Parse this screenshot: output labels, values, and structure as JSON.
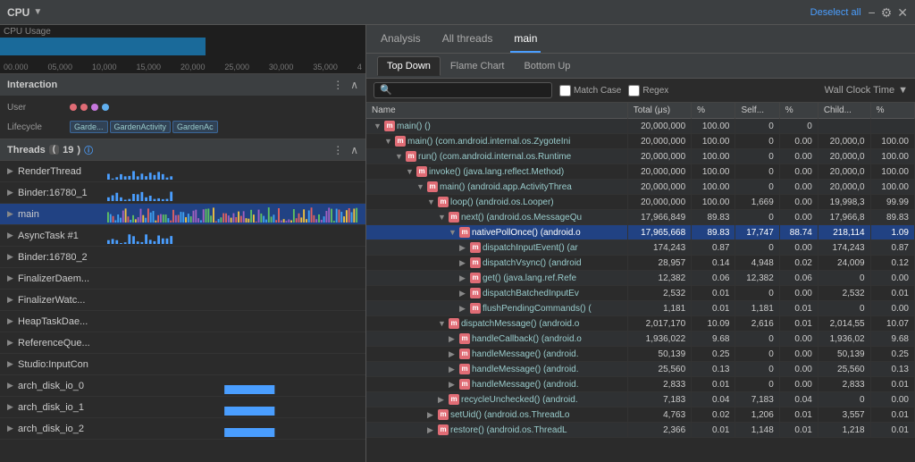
{
  "topbar": {
    "cpu_label": "CPU",
    "deselect_all": "Deselect all"
  },
  "tabs": {
    "items": [
      "Analysis",
      "All threads",
      "main"
    ],
    "active": "main"
  },
  "sub_tabs": {
    "items": [
      "Top Down",
      "Flame Chart",
      "Bottom Up"
    ],
    "active": "Top Down"
  },
  "search": {
    "placeholder": "🔍",
    "match_case": "Match Case",
    "regex": "Regex",
    "wall_clock": "Wall Clock Time"
  },
  "table": {
    "headers": [
      "Name",
      "Total (μs)",
      "%",
      "Self...",
      "%",
      "Child...",
      "%"
    ],
    "rows": [
      {
        "indent": 0,
        "expand": "▼",
        "icon": "m",
        "name": "main() ()",
        "total": "20,000,000",
        "total_pct": "100.00",
        "self": "0",
        "self_pct": "0",
        "child": "",
        "child_pct": "",
        "selected": false
      },
      {
        "indent": 1,
        "expand": "▼",
        "icon": "m",
        "name": "main() (com.android.internal.os.ZygoteIni",
        "total": "20,000,000",
        "total_pct": "100.00",
        "self": "0",
        "self_pct": "0.00",
        "child": "20,000,0",
        "child_pct": "100.00",
        "selected": false
      },
      {
        "indent": 2,
        "expand": "▼",
        "icon": "m",
        "name": "run() (com.android.internal.os.Runtime",
        "total": "20,000,000",
        "total_pct": "100.00",
        "self": "0",
        "self_pct": "0.00",
        "child": "20,000,0",
        "child_pct": "100.00",
        "selected": false
      },
      {
        "indent": 3,
        "expand": "▼",
        "icon": "m",
        "name": "invoke() (java.lang.reflect.Method)",
        "total": "20,000,000",
        "total_pct": "100.00",
        "self": "0",
        "self_pct": "0.00",
        "child": "20,000,0",
        "child_pct": "100.00",
        "selected": false
      },
      {
        "indent": 4,
        "expand": "▼",
        "icon": "m",
        "name": "main() (android.app.ActivityThrea",
        "total": "20,000,000",
        "total_pct": "100.00",
        "self": "0",
        "self_pct": "0.00",
        "child": "20,000,0",
        "child_pct": "100.00",
        "selected": false
      },
      {
        "indent": 5,
        "expand": "▼",
        "icon": "m",
        "name": "loop() (android.os.Looper)",
        "total": "20,000,000",
        "total_pct": "100.00",
        "self": "1,669",
        "self_pct": "0.00",
        "child": "19,998,3",
        "child_pct": "99.99",
        "selected": false
      },
      {
        "indent": 6,
        "expand": "▼",
        "icon": "m",
        "name": "next() (android.os.MessageQu",
        "total": "17,966,849",
        "total_pct": "89.83",
        "self": "0",
        "self_pct": "0.00",
        "child": "17,966,8",
        "child_pct": "89.83",
        "selected": false
      },
      {
        "indent": 7,
        "expand": "▼",
        "icon": "m",
        "name": "nativePollOnce() (android.o",
        "total": "17,965,668",
        "total_pct": "89.83",
        "self": "17,747",
        "self_pct": "88.74",
        "child": "218,114",
        "child_pct": "1.09",
        "selected": true
      },
      {
        "indent": 8,
        "expand": "▶",
        "icon": "m",
        "name": "dispatchInputEvent() (ar",
        "total": "174,243",
        "total_pct": "0.87",
        "self": "0",
        "self_pct": "0.00",
        "child": "174,243",
        "child_pct": "0.87",
        "selected": false
      },
      {
        "indent": 8,
        "expand": "▶",
        "icon": "m",
        "name": "dispatchVsync() (android",
        "total": "28,957",
        "total_pct": "0.14",
        "self": "4,948",
        "self_pct": "0.02",
        "child": "24,009",
        "child_pct": "0.12",
        "selected": false
      },
      {
        "indent": 8,
        "expand": "▶",
        "icon": "m",
        "name": "get() (java.lang.ref.Refe",
        "total": "12,382",
        "total_pct": "0.06",
        "self": "12,382",
        "self_pct": "0.06",
        "child": "0",
        "child_pct": "0.00",
        "selected": false
      },
      {
        "indent": 8,
        "expand": "▶",
        "icon": "m",
        "name": "dispatchBatchedInputEv",
        "total": "2,532",
        "total_pct": "0.01",
        "self": "0",
        "self_pct": "0.00",
        "child": "2,532",
        "child_pct": "0.01",
        "selected": false
      },
      {
        "indent": 8,
        "expand": "▶",
        "icon": "m",
        "name": "flushPendingCommands() (",
        "total": "1,181",
        "total_pct": "0.01",
        "self": "1,181",
        "self_pct": "0.01",
        "child": "0",
        "child_pct": "0.00",
        "selected": false
      },
      {
        "indent": 6,
        "expand": "▼",
        "icon": "m",
        "name": "dispatchMessage() (android.o",
        "total": "2,017,170",
        "total_pct": "10.09",
        "self": "2,616",
        "self_pct": "0.01",
        "child": "2,014,55",
        "child_pct": "10.07",
        "selected": false
      },
      {
        "indent": 7,
        "expand": "▶",
        "icon": "m",
        "name": "handleCallback() (android.o",
        "total": "1,936,022",
        "total_pct": "9.68",
        "self": "0",
        "self_pct": "0.00",
        "child": "1,936,02",
        "child_pct": "9.68",
        "selected": false
      },
      {
        "indent": 7,
        "expand": "▶",
        "icon": "m",
        "name": "handleMessage() (android.",
        "total": "50,139",
        "total_pct": "0.25",
        "self": "0",
        "self_pct": "0.00",
        "child": "50,139",
        "child_pct": "0.25",
        "selected": false
      },
      {
        "indent": 7,
        "expand": "▶",
        "icon": "m",
        "name": "handleMessage() (android.",
        "total": "25,560",
        "total_pct": "0.13",
        "self": "0",
        "self_pct": "0.00",
        "child": "25,560",
        "child_pct": "0.13",
        "selected": false
      },
      {
        "indent": 7,
        "expand": "▶",
        "icon": "m",
        "name": "handleMessage() (android.",
        "total": "2,833",
        "total_pct": "0.01",
        "self": "0",
        "self_pct": "0.00",
        "child": "2,833",
        "child_pct": "0.01",
        "selected": false
      },
      {
        "indent": 6,
        "expand": "▶",
        "icon": "m",
        "name": "recycleUnchecked() (android.",
        "total": "7,183",
        "total_pct": "0.04",
        "self": "7,183",
        "self_pct": "0.04",
        "child": "0",
        "child_pct": "0.00",
        "selected": false
      },
      {
        "indent": 5,
        "expand": "▶",
        "icon": "m",
        "name": "setUid() (android.os.ThreadLo",
        "total": "4,763",
        "total_pct": "0.02",
        "self": "1,206",
        "self_pct": "0.01",
        "child": "3,557",
        "child_pct": "0.01",
        "selected": false
      },
      {
        "indent": 5,
        "expand": "▶",
        "icon": "m",
        "name": "restore() (android.os.ThreadL",
        "total": "2,366",
        "total_pct": "0.01",
        "self": "1,148",
        "self_pct": "0.01",
        "child": "1,218",
        "child_pct": "0.01",
        "selected": false
      }
    ]
  },
  "left_panel": {
    "interaction_label": "Interaction",
    "user_label": "User",
    "lifecycle_label": "Lifecycle",
    "lifecycle_items": [
      "Garde...",
      "GardenActivity",
      "GardenAc"
    ],
    "threads_label": "Threads",
    "threads_count": "19",
    "thread_list": [
      {
        "name": "RenderThread",
        "active": false
      },
      {
        "name": "Binder:16780_1",
        "active": false
      },
      {
        "name": "main",
        "active": true
      },
      {
        "name": "AsyncTask #1",
        "active": false
      },
      {
        "name": "Binder:16780_2",
        "active": false
      },
      {
        "name": "FinalizerDaem...",
        "active": false
      },
      {
        "name": "FinalizerWatc...",
        "active": false
      },
      {
        "name": "HeapTaskDae...",
        "active": false
      },
      {
        "name": "ReferenceQue...",
        "active": false
      },
      {
        "name": "Studio:InputCon",
        "active": false
      },
      {
        "name": "arch_disk_io_0",
        "active": false
      },
      {
        "name": "arch_disk_io_1",
        "active": false
      },
      {
        "name": "arch_disk_io_2",
        "active": false
      }
    ],
    "timeline_labels": [
      "00.000",
      "05,000",
      "10,000",
      "15,000",
      "20,000",
      "25,000",
      "30,000",
      "35,000",
      "4"
    ]
  }
}
